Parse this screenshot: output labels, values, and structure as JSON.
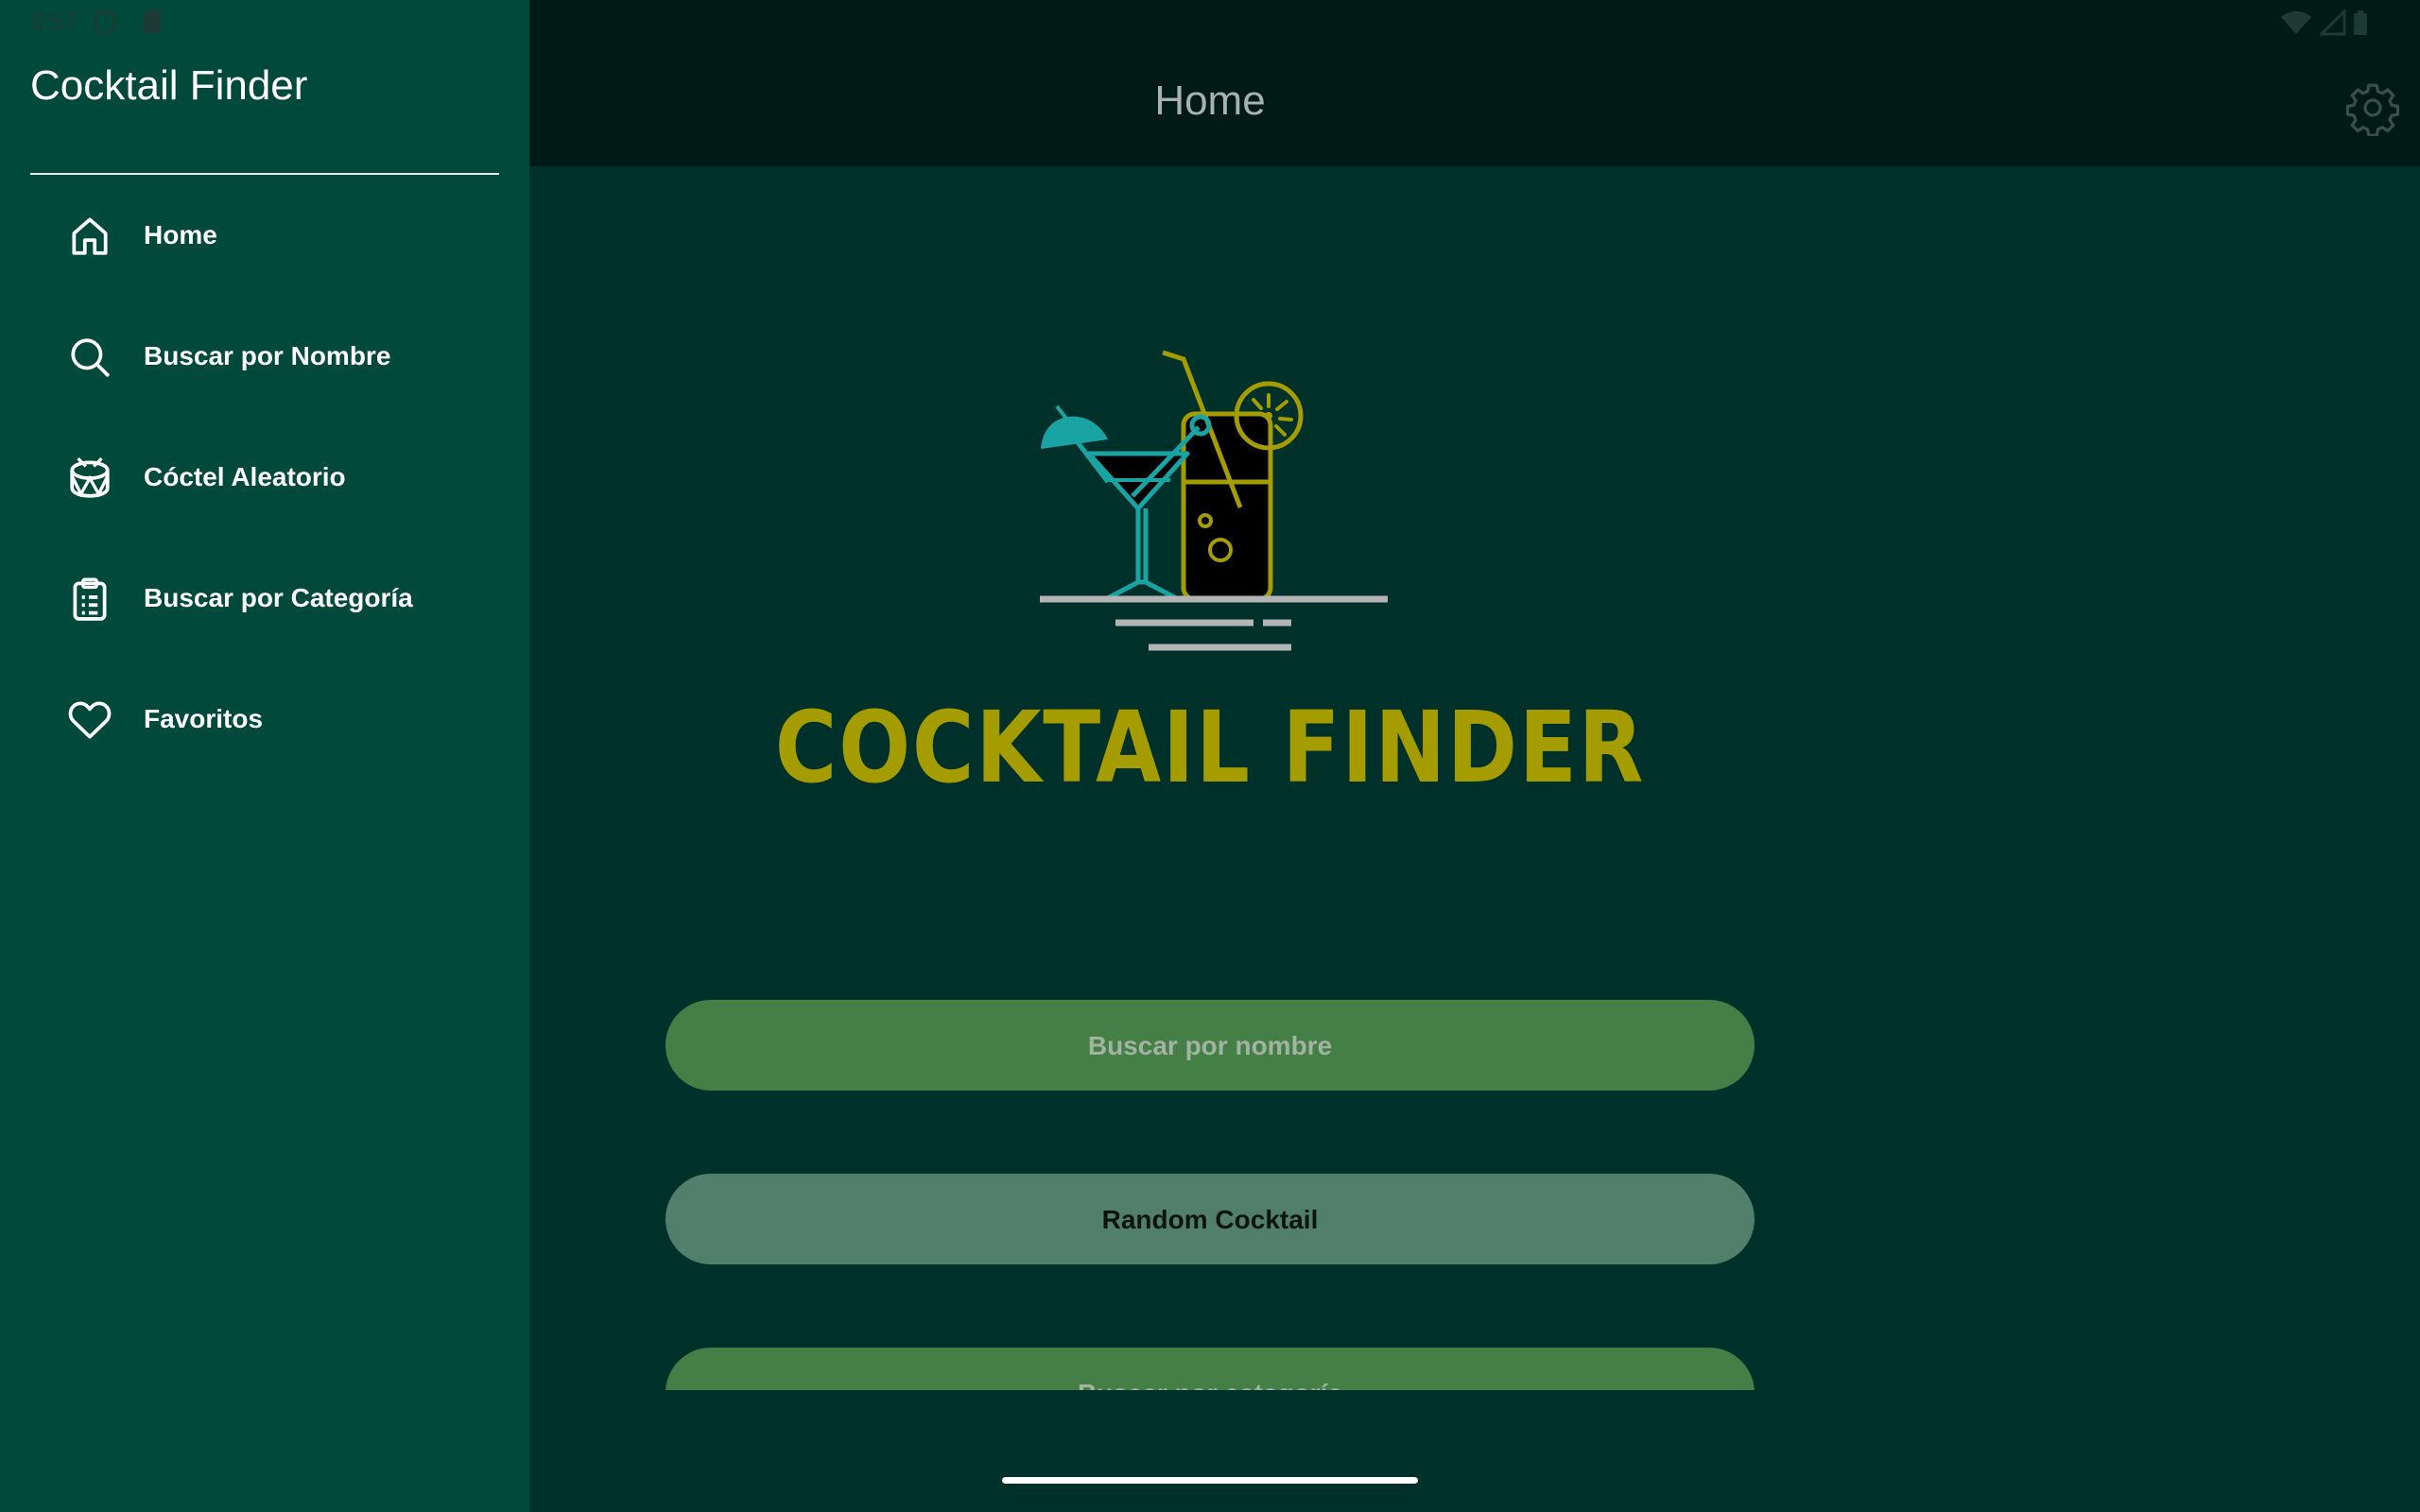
{
  "status_bar": {
    "time": "9:57"
  },
  "drawer": {
    "title": "Cocktail Finder",
    "items": [
      {
        "label": "Home",
        "icon": "home-icon"
      },
      {
        "label": "Buscar por Nombre",
        "icon": "search-icon"
      },
      {
        "label": "Cóctel Aleatorio",
        "icon": "drum-icon"
      },
      {
        "label": "Buscar por Categoría",
        "icon": "clipboard-list-icon"
      },
      {
        "label": "Favoritos",
        "icon": "heart-icon"
      }
    ]
  },
  "app_bar": {
    "title": "Home",
    "settings_icon": "gear-icon"
  },
  "main": {
    "brand_title": "COCKTAIL FINDER",
    "buttons": {
      "search_name": "Buscar por nombre",
      "random": "Random Cocktail",
      "search_category": "Buscar por categoría"
    }
  },
  "colors": {
    "drawer_bg": "#00493b",
    "main_bg": "#00302a",
    "app_bar_bg": "#001a16",
    "brand_gold": "#a59d00",
    "logo_teal": "#1aa3a3",
    "primary_button": "#447f45",
    "secondary_button": "#517f6c"
  }
}
